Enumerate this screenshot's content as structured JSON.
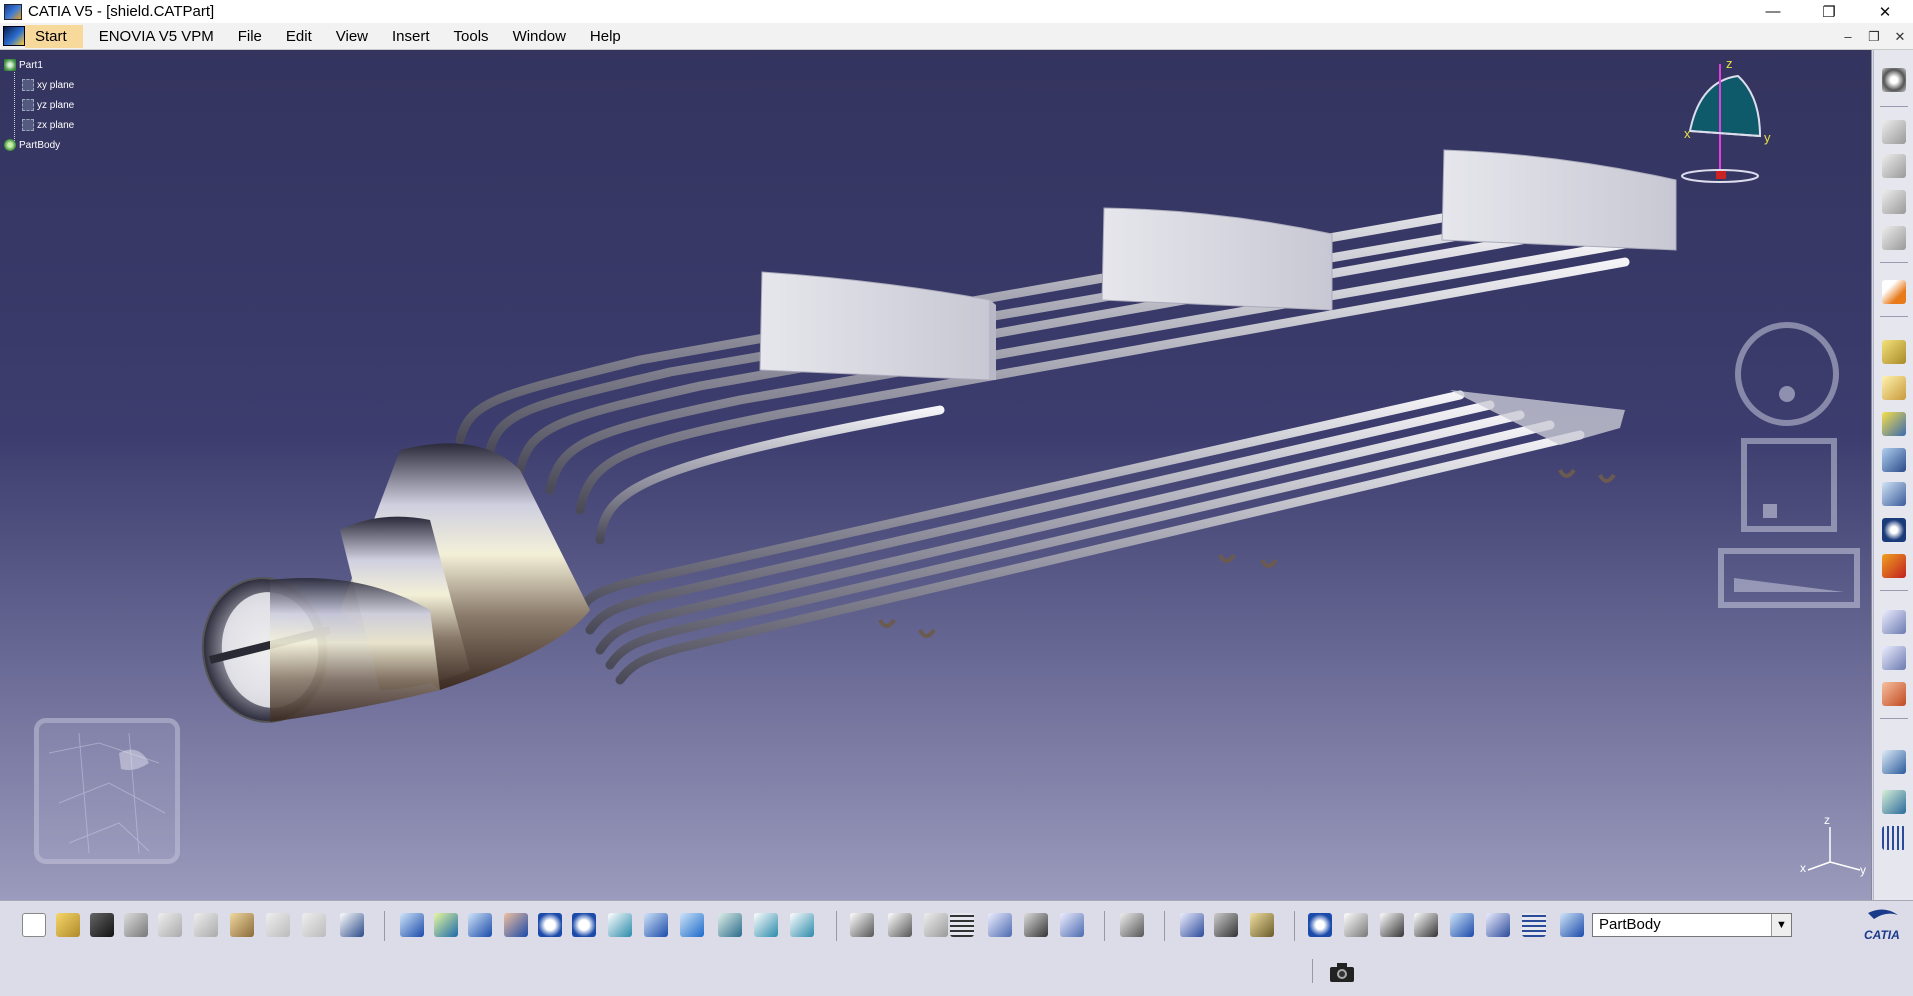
{
  "window": {
    "title": "CATIA V5 - [shield.CATPart]",
    "minimize": "—",
    "restore": "❐",
    "close": "✕"
  },
  "menubar": {
    "items": [
      "Start",
      "ENOVIA V5 VPM",
      "File",
      "Edit",
      "View",
      "Insert",
      "Tools",
      "Window",
      "Help"
    ],
    "mdi_minimize": "–",
    "mdi_restore": "❐",
    "mdi_close": "✕"
  },
  "spec_tree": {
    "root": "Part1",
    "children": [
      "xy plane",
      "yz plane",
      "zx plane",
      "PartBody"
    ]
  },
  "compass": {
    "axis_x": "x",
    "axis_y": "y",
    "axis_z": "z"
  },
  "mini_axes": {
    "axis_x": "x",
    "axis_y": "y",
    "axis_z": "z"
  },
  "bottom_toolbar": {
    "body_select_value": "PartBody",
    "logo_text": "CATIA"
  },
  "colors": {
    "viewport_top": "#34345f",
    "viewport_bottom": "#9b9bbd",
    "model_metal": "#c9c9d4",
    "start_highlight": "#f7d99c"
  }
}
